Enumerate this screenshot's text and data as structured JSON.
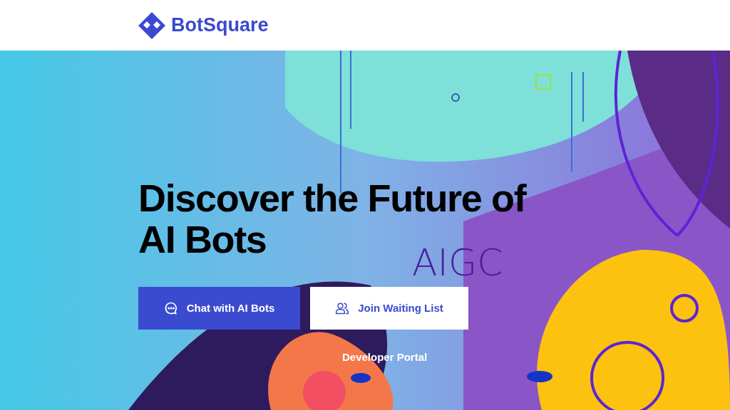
{
  "header": {
    "logo_text": "BotSquare"
  },
  "hero": {
    "title": "Discover the Future of AI Bots",
    "artwork_text": "AIGC",
    "buttons": [
      {
        "label": "Chat with AI Bots",
        "kind": "primary"
      },
      {
        "label": "Join Waiting List",
        "kind": "secondary"
      }
    ],
    "link": "Developer Portal"
  }
}
